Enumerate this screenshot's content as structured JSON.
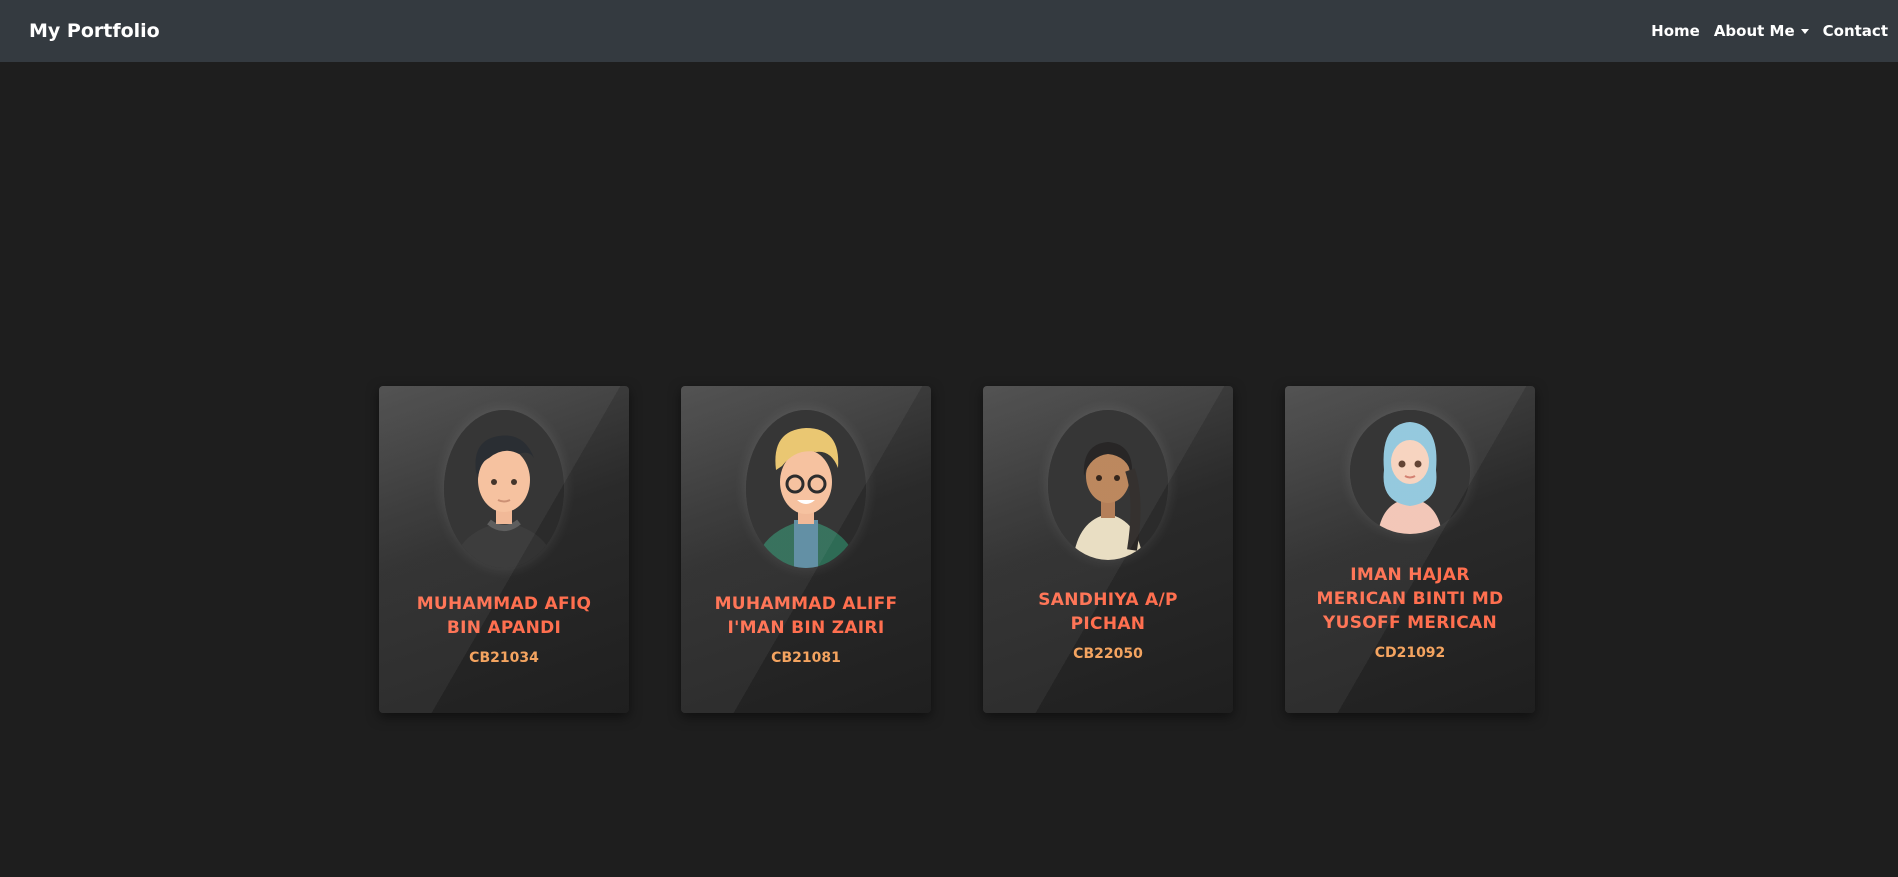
{
  "navbar": {
    "brand": "My Portfolio",
    "links": [
      {
        "label": "Home"
      },
      {
        "label": "About Me"
      },
      {
        "label": "Contact"
      }
    ]
  },
  "members": [
    {
      "name": "MUHAMMAD AFIQ BIN APANDI",
      "id": "CB21034",
      "avatar": "boy-dark-hair-avatar"
    },
    {
      "name": "MUHAMMAD ALIFF I'MAN BIN ZAIRI",
      "id": "CB21081",
      "avatar": "boy-blonde-glasses-avatar"
    },
    {
      "name": "SANDHIYA A/P PICHAN",
      "id": "CB22050",
      "avatar": "girl-braid-avatar"
    },
    {
      "name": "IMAN HAJAR MERICAN BINTI MD YUSOFF MERICAN",
      "id": "CD21092",
      "avatar": "girl-hijab-avatar"
    }
  ]
}
